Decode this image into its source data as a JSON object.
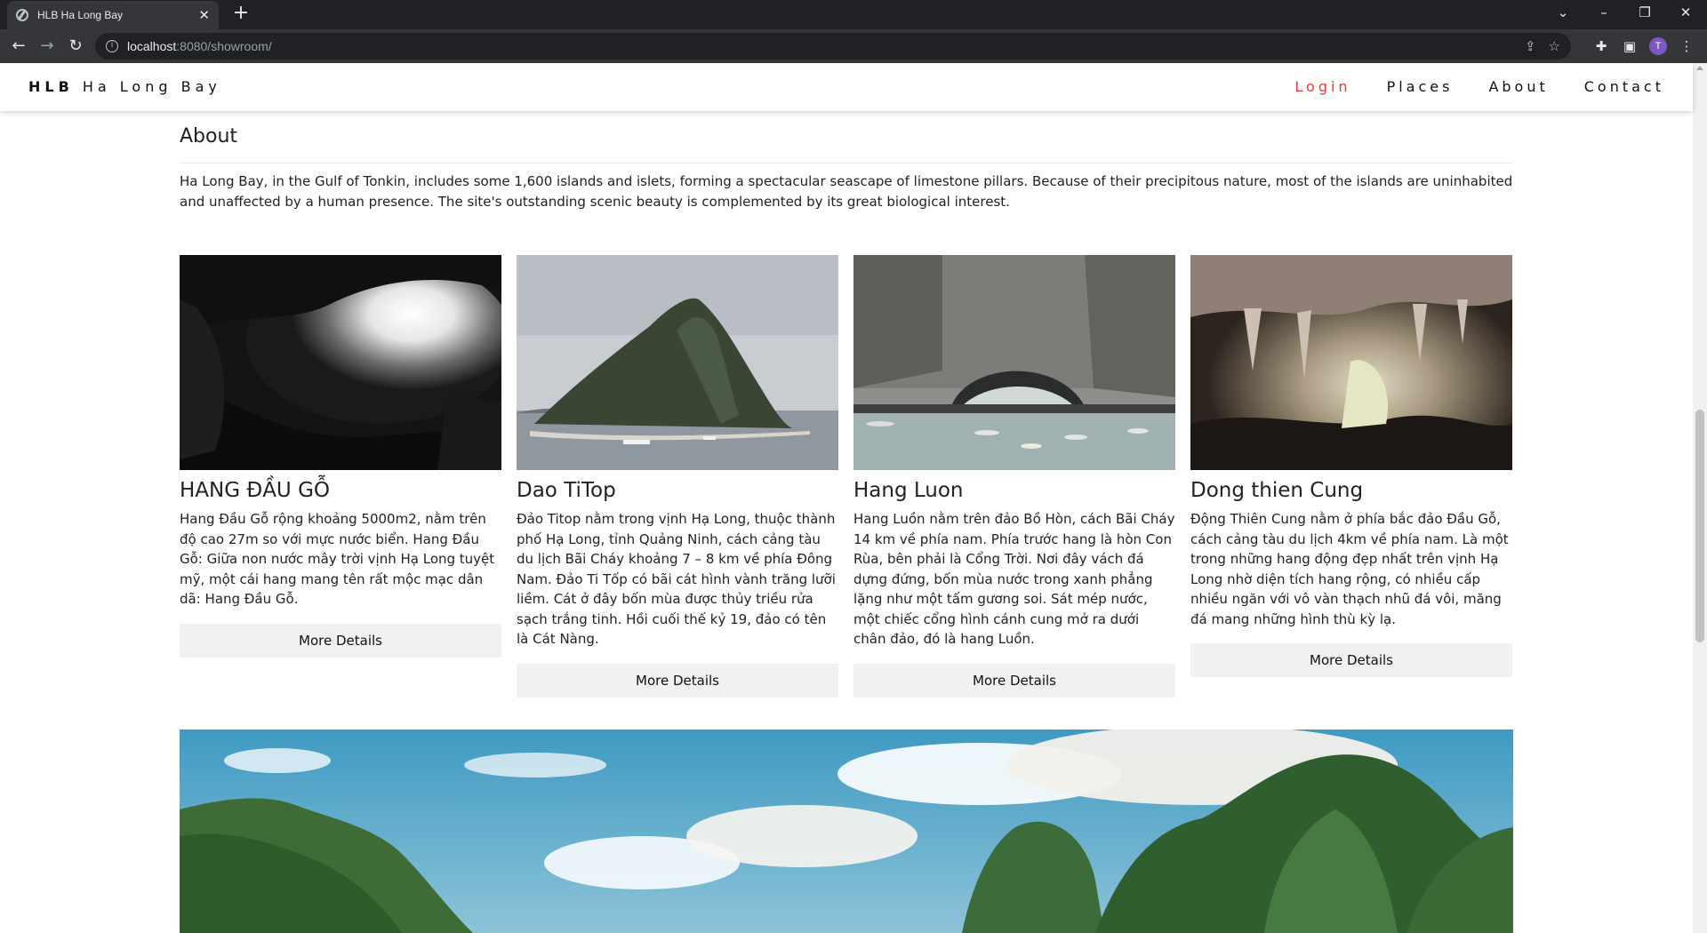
{
  "browser": {
    "tab_title": "HLB Ha Long Bay",
    "tab_close": "✕",
    "new_tab": "+",
    "url_host": "localhost",
    "url_rest": ":8080/showroom/",
    "profile_initial": "T",
    "icons": [
      "back-icon",
      "forward-icon",
      "reload-icon",
      "info-icon",
      "share-icon",
      "star-icon",
      "extensions-icon",
      "sidepanel-icon",
      "menu-icon"
    ]
  },
  "site": {
    "brand_bold": "HLB",
    "brand_rest": "Ha Long Bay",
    "nav": {
      "login": "Login",
      "places": "Places",
      "about": "About",
      "contact": "Contact"
    },
    "colors": {
      "login": "#e53935",
      "button_bg": "#f1f1f1"
    }
  },
  "about": {
    "title": "About",
    "text": "Ha Long Bay, in the Gulf of Tonkin, includes some 1,600 islands and islets, forming a spectacular seascape of limestone pillars. Because of their precipitous nature, most of the islands are uninhabited and unaffected by a human presence. The site's outstanding scenic beauty is complemented by its great biological interest."
  },
  "places": [
    {
      "title": "HANG ĐẦU GỖ",
      "description": "Hang Đầu Gỗ rộng khoảng 5000m2, nằm trên độ cao 27m so với mực nước biển. Hang Đầu Gỗ: Giữa non nước mây trời vịnh Hạ Long tuyệt mỹ, một cái hang mang tên rất mộc mạc dân dã: Hang Đầu Gỗ.",
      "button": "More Details"
    },
    {
      "title": "Dao TiTop",
      "description": "Đảo Titop nằm trong vịnh Hạ Long, thuộc thành phố Hạ Long, tỉnh Quảng Ninh, cách cảng tàu du lịch Bãi Cháy khoảng 7 – 8 km về phía Đông Nam. Đảo Ti Tốp có bãi cát hình vành trăng lưỡi liềm. Cát ở đây bốn mùa được thủy triều rửa sạch trắng tinh. Hồi cuối thế kỷ 19, đảo có tên là Cát Nàng.",
      "button": "More Details"
    },
    {
      "title": "Hang Luon",
      "description": "Hang Luồn nằm trên đảo Bồ Hòn, cách Bãi Cháy 14 km về phía nam. Phía trước hang là hòn Con Rùa, bên phải là Cổng Trời. Nơi đây vách đá dựng đứng, bốn mùa nước trong xanh phẳng lặng như một tấm gương soi. Sát mép nước, một chiếc cổng hình cánh cung mở ra dưới chân đảo, đó là hang Luồn.",
      "button": "More Details"
    },
    {
      "title": "Dong thien Cung",
      "description": "Động Thiên Cung nằm ở phía bắc đảo Đầu Gỗ, cách cảng tàu du lịch 4km về phía nam. Là một trong những hang động đẹp nhất trên vịnh Hạ Long nhờ diện tích hang rộng, có nhiều cấp nhiều ngăn với vô vàn thạch nhũ đá vôi, măng đá mang những hình thù kỳ lạ.",
      "button": "More Details"
    }
  ]
}
